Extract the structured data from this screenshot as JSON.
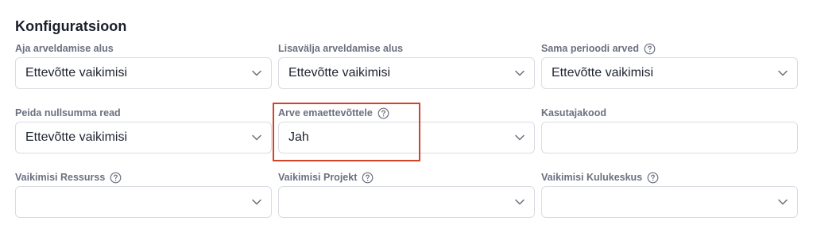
{
  "section": {
    "title": "Konfiguratsioon"
  },
  "fields": {
    "aja_arveldamise_alus": {
      "label": "Aja arveldamise alus",
      "value": "Ettevõtte vaikimisi"
    },
    "lisavalja_arveldamise_alus": {
      "label": "Lisavälja arveldamise alus",
      "value": "Ettevõtte vaikimisi"
    },
    "sama_perioodi_arved": {
      "label": "Sama perioodi arved",
      "value": "Ettevõtte vaikimisi"
    },
    "peida_nullsumma_read": {
      "label": "Peida nullsumma read",
      "value": "Ettevõtte vaikimisi"
    },
    "arve_emaettevottele": {
      "label": "Arve emaettevõttele",
      "value": "Jah"
    },
    "kasutajakood": {
      "label": "Kasutajakood",
      "value": ""
    },
    "vaikimisi_ressurss": {
      "label": "Vaikimisi Ressurss",
      "value": ""
    },
    "vaikimisi_projekt": {
      "label": "Vaikimisi Projekt",
      "value": ""
    },
    "vaikimisi_kulukeskus": {
      "label": "Vaikimisi Kulukeskus",
      "value": ""
    }
  },
  "icons": {
    "help": "question-circle-icon",
    "dropdown": "chevron-down-icon"
  },
  "colors": {
    "highlight": "#d0452a",
    "border": "#d9dce3",
    "label": "#6b7080",
    "text": "#1f2330"
  }
}
